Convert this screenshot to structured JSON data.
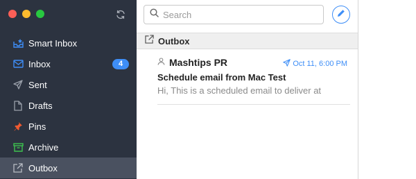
{
  "window": {
    "traffic_lights": {
      "close": "#fc5f57",
      "minimize": "#fdbc2e",
      "zoom": "#28c840"
    }
  },
  "sidebar": {
    "background": "#2c3340",
    "sync_icon": "sync-icon",
    "items": [
      {
        "label": "Smart Inbox",
        "icon": "smart-inbox-icon",
        "color": "#3e8ef7"
      },
      {
        "label": "Inbox",
        "icon": "inbox-icon",
        "color": "#3e8ef7",
        "badge": "4"
      },
      {
        "label": "Sent",
        "icon": "paper-plane-icon",
        "color": "#9aa0aa"
      },
      {
        "label": "Drafts",
        "icon": "document-icon",
        "color": "#9aa0aa"
      },
      {
        "label": "Pins",
        "icon": "pin-icon",
        "color": "#f25a30"
      },
      {
        "label": "Archive",
        "icon": "archive-icon",
        "color": "#3ec24f"
      },
      {
        "label": "Outbox",
        "icon": "outbox-icon",
        "color": "#9aa0aa",
        "selected": true
      }
    ]
  },
  "list": {
    "search": {
      "placeholder": "Search",
      "icon": "search-icon"
    },
    "compose_icon": "pencil-icon",
    "section": {
      "label": "Outbox",
      "icon": "outbox-icon"
    },
    "messages": [
      {
        "sender": "Mashtips PR",
        "date": "Oct 11, 6:00 PM",
        "subject": "Schedule email from Mac Test",
        "preview": "Hi, This is a scheduled email to deliver at"
      }
    ]
  },
  "accent": "#3e8ef7"
}
